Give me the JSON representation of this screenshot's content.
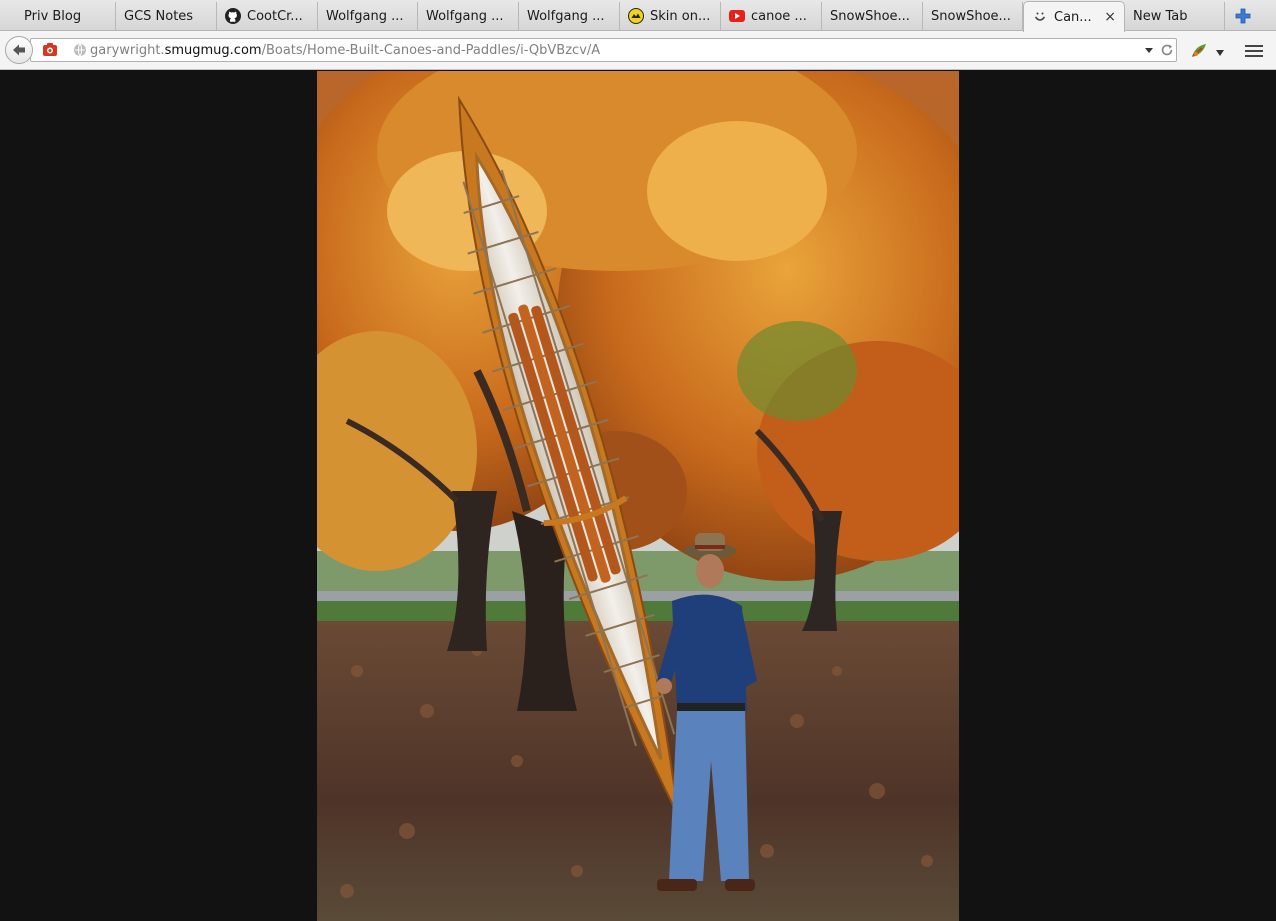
{
  "browser": {
    "tabs": [
      {
        "label": "Priv Blog",
        "icon": "none"
      },
      {
        "label": "GCS Notes",
        "icon": "none"
      },
      {
        "label": "CootCr...",
        "icon": "github-icon"
      },
      {
        "label": "Wolfgang ...",
        "icon": "none"
      },
      {
        "label": "Wolfgang ...",
        "icon": "none"
      },
      {
        "label": "Wolfgang ...",
        "icon": "none"
      },
      {
        "label": "Skin on...",
        "icon": "yellow-circle-icon"
      },
      {
        "label": "canoe ...",
        "icon": "youtube-icon"
      },
      {
        "label": "SnowShoe...",
        "icon": "none"
      },
      {
        "label": "SnowShoe...",
        "icon": "none"
      },
      {
        "label": "Can...",
        "icon": "smugmug-icon",
        "active": true
      },
      {
        "label": "New Tab",
        "icon": "none"
      }
    ],
    "active_tab_close": "×",
    "url": {
      "prefix": "garywright.",
      "domain": "smugmug.com",
      "path": "/Boats/Home-Built-Canoes-and-Paddles/i-QbVBzcv/A"
    }
  },
  "photo": {
    "subject": "Man holding a skin-on-frame canoe upright in front of autumn trees"
  },
  "colors": {
    "page_background": "#121212",
    "tab_strip": "#dcdcdc",
    "new_tab_plus": "#3a7bd5"
  }
}
